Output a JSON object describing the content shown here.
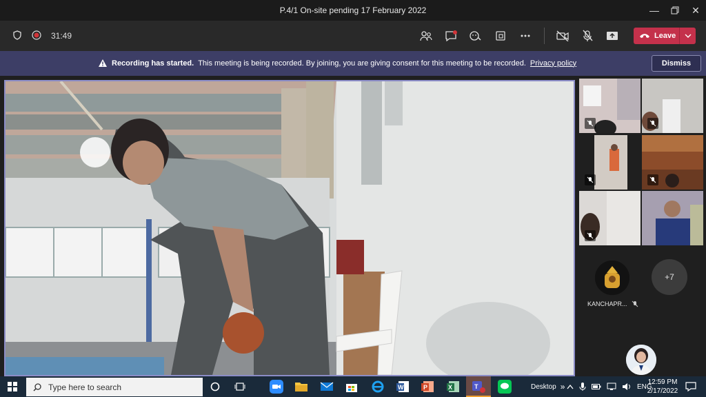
{
  "window": {
    "title": "P.4/1 On-site pending 17 February 2022"
  },
  "toolbar": {
    "timer": "31:49",
    "leave_label": "Leave"
  },
  "banner": {
    "bold": "Recording has started.",
    "text": "This meeting is being recorded. By joining, you are giving consent for this meeting to be recorded.",
    "link": "Privacy policy",
    "dismiss_label": "Dismiss"
  },
  "gallery": {
    "participant_name": "KANCHAPR...",
    "more_count": "+7"
  },
  "taskbar": {
    "search_placeholder": "Type here to search",
    "desktop_label": "Desktop",
    "lang": "ENG",
    "time": "12:59 PM",
    "date": "2/17/2022"
  },
  "colors": {
    "leave": "#c4314b",
    "banner": "#3d3e66",
    "active_border": "#8b8cc7"
  }
}
